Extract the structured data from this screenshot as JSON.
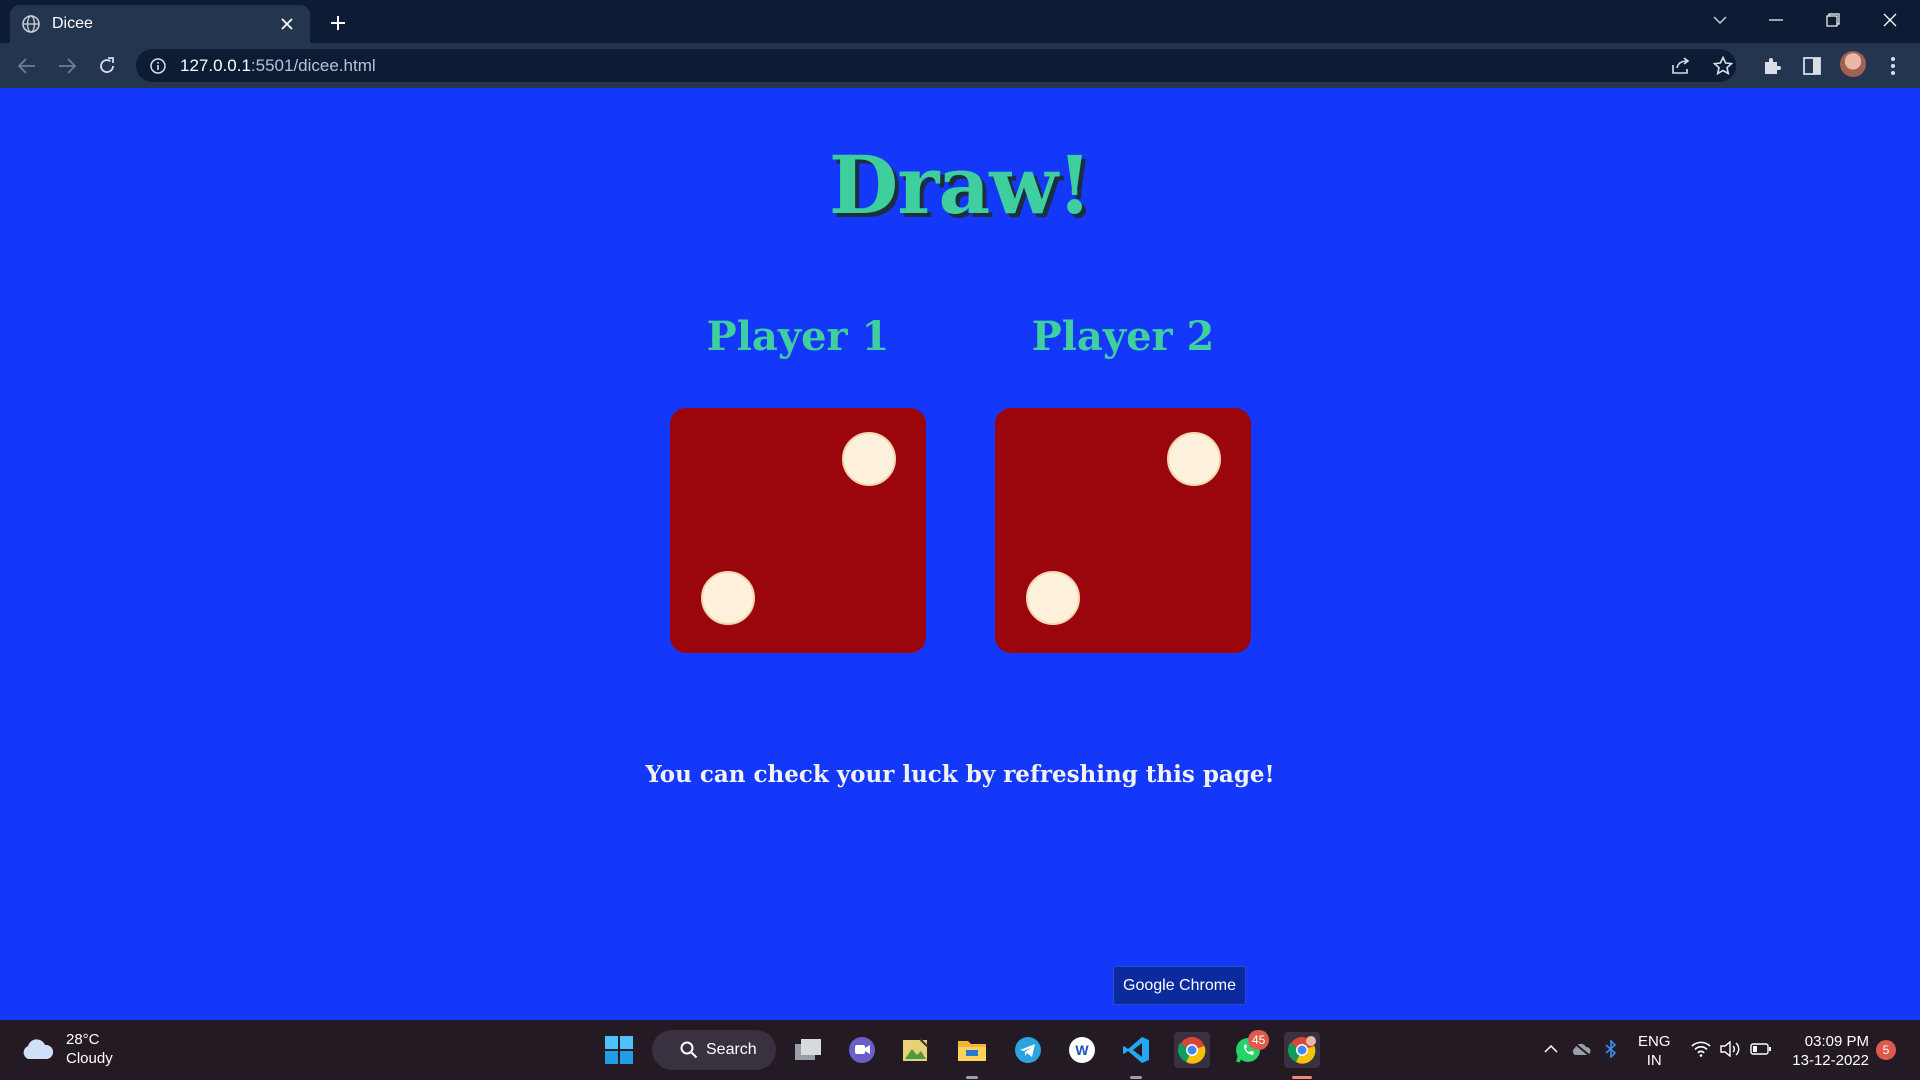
{
  "browser": {
    "tab_title": "Dicee",
    "url_host": "127.0.0.1",
    "url_path": ":5501/dicee.html"
  },
  "page": {
    "heading": "Draw!",
    "players": [
      {
        "label": "Player 1",
        "die_value": 2
      },
      {
        "label": "Player 2",
        "die_value": 2
      }
    ],
    "hint": "You can check your luck by refreshing this page!",
    "colors": {
      "background": "#1438fa",
      "heading": "#3fcf9f",
      "die": "#9b060d",
      "pip": "#fdf1dc"
    }
  },
  "tooltip": "Google Chrome",
  "taskbar": {
    "weather_temp": "28°C",
    "weather_desc": "Cloudy",
    "search_label": "Search",
    "whatsapp_badge": "45",
    "lang_line1": "ENG",
    "lang_line2": "IN",
    "time": "03:09 PM",
    "date": "13-12-2022",
    "notification_count": "5"
  }
}
